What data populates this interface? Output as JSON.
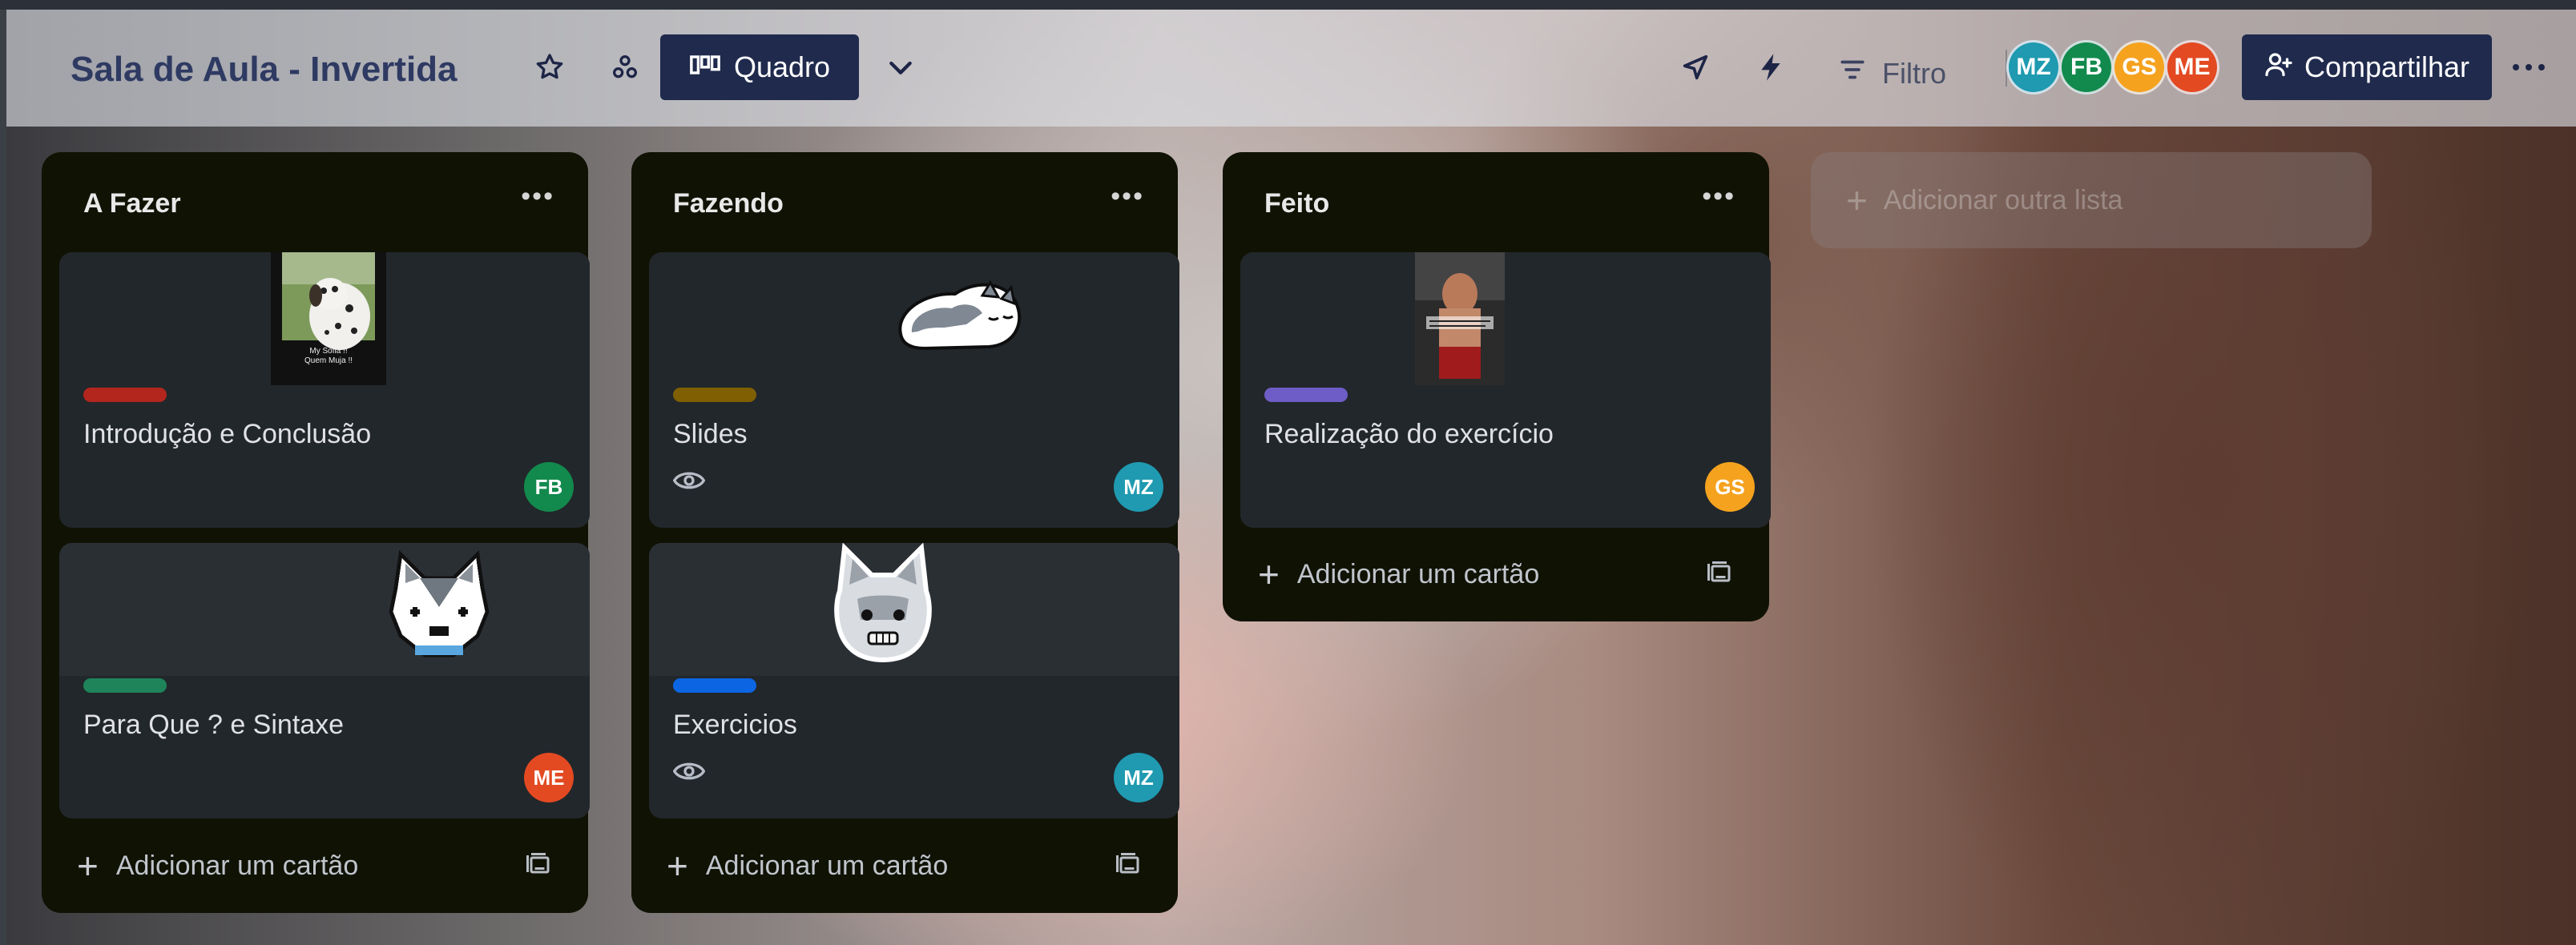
{
  "header": {
    "board_title": "Sala de Aula - Invertida",
    "view_label": "Quadro",
    "filter_label": "Filtro",
    "share_label": "Compartilhar",
    "members": [
      {
        "initials": "MZ",
        "color": "#1f9ab0"
      },
      {
        "initials": "FB",
        "color": "#128a4d"
      },
      {
        "initials": "GS",
        "color": "#f5a21e"
      },
      {
        "initials": "ME",
        "color": "#e34a22"
      }
    ],
    "icons": [
      "star-icon",
      "workspace-visibility-icon",
      "board-view-icon",
      "chevron-down-icon",
      "rocket-icon",
      "lightning-icon",
      "filter-icon",
      "share-add-user-icon",
      "more-icon"
    ]
  },
  "lists": [
    {
      "title": "A Fazer",
      "cards": [
        {
          "title": "Introdução e Conclusão",
          "label_color": "#b3261e",
          "member": "FB",
          "member_color": "#128a4d",
          "cover": "dalmatian-photo",
          "cover_caption": "My Sofia !!\nQuem Muja !!"
        },
        {
          "title": "Para Que ? e Sintaxe",
          "label_color": "#1f845a",
          "member": "ME",
          "member_color": "#e34a22",
          "cover": "husky-sticker-pixel"
        }
      ],
      "add_card_label": "Adicionar um cartão"
    },
    {
      "title": "Fazendo",
      "cards": [
        {
          "title": "Slides",
          "label_color": "#7f5f01",
          "member": "MZ",
          "member_color": "#1f9ab0",
          "cover": "husky-sticker-sleeping",
          "watch": true
        },
        {
          "title": "Exercicios",
          "label_color": "#0c66e4",
          "member": "MZ",
          "member_color": "#1f9ab0",
          "cover": "husky-sticker-face",
          "watch": true
        }
      ],
      "add_card_label": "Adicionar um cartão"
    },
    {
      "title": "Feito",
      "cards": [
        {
          "title": "Realização do exercício",
          "label_color": "#6e5dc6",
          "member": "GS",
          "member_color": "#f5a21e",
          "cover": "gym-photo"
        }
      ],
      "add_card_label": "Adicionar um cartão"
    }
  ],
  "add_list_label": "Adicionar outra lista"
}
